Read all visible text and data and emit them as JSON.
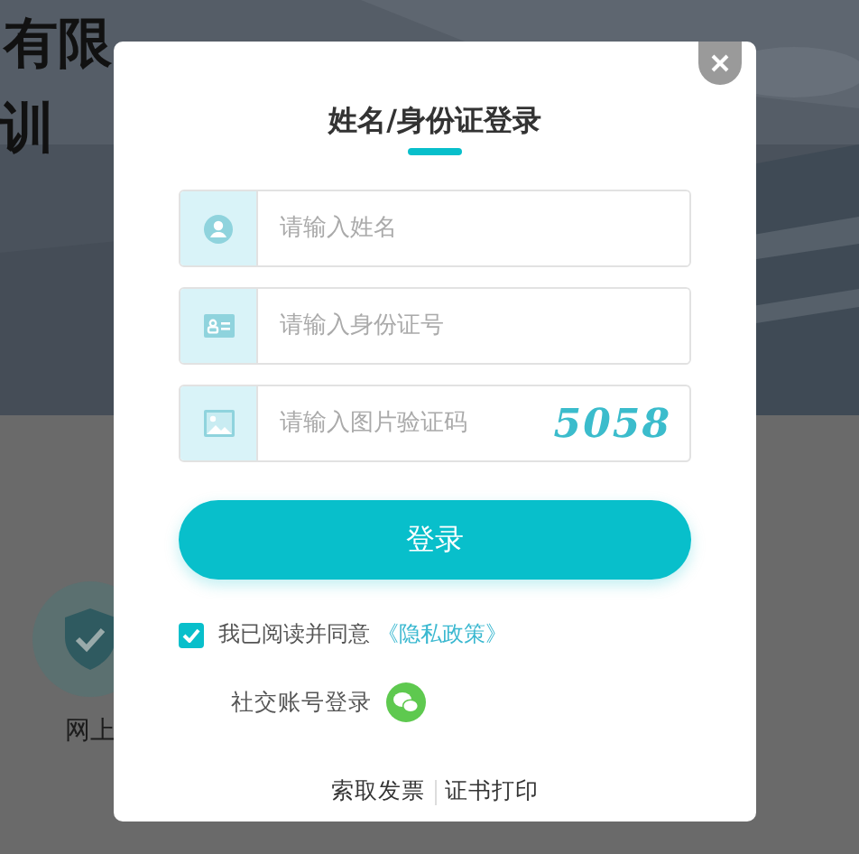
{
  "background": {
    "hero": {
      "kind": "picture",
      "title": "有限",
      "subtitle": "训"
    },
    "services": [
      {
        "label": "网上"
      }
    ]
  },
  "modal": {
    "title": "姓名/身份证登录",
    "fields": [
      {
        "kind": "name",
        "placeholder": "请输入姓名"
      },
      {
        "kind": "id",
        "placeholder": "请输入身份证号"
      },
      {
        "kind": "captcha",
        "placeholder": "请输入图片验证码",
        "captcha": "5058"
      }
    ],
    "submit": "登录",
    "agreement": {
      "checked": true,
      "text": "我已阅读并同意",
      "link": "《隐私政策》"
    },
    "social": {
      "label": "社交账号登录"
    },
    "footer_links": [
      "索取发票",
      "证书打印"
    ]
  }
}
